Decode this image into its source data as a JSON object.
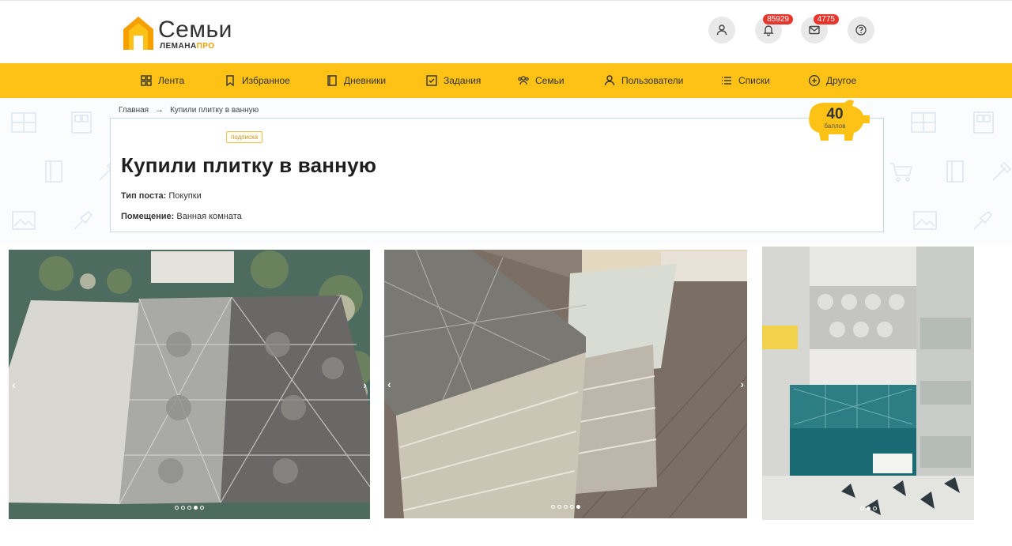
{
  "brand": {
    "title": "Семьи",
    "sub_main": "ЛЕМАНА",
    "sub_pro": "ПРО"
  },
  "header": {
    "notifications_count": "85929",
    "messages_count": "4775"
  },
  "nav": [
    {
      "label": "Лента",
      "icon": "grid-icon"
    },
    {
      "label": "Избранное",
      "icon": "bookmark-icon"
    },
    {
      "label": "Дневники",
      "icon": "book-icon"
    },
    {
      "label": "Задания",
      "icon": "checkbox-icon"
    },
    {
      "label": "Семьи",
      "icon": "people-icon"
    },
    {
      "label": "Пользователи",
      "icon": "user-icon"
    },
    {
      "label": "Списки",
      "icon": "list-icon"
    },
    {
      "label": "Другое",
      "icon": "plus-circle-icon"
    }
  ],
  "breadcrumb": {
    "home": "Главная",
    "arrow": "→",
    "current": "Купили плитку в ванную"
  },
  "post": {
    "tag": "подписка",
    "title": "Купили плитку в ванную",
    "type_label": "Тип поста:",
    "type_value": "Покупки",
    "room_label": "Помещение:",
    "room_value": "Ванная комната"
  },
  "points": {
    "value": "40",
    "label": "баллов"
  },
  "gallery": [
    {
      "dots": 5,
      "active": 3
    },
    {
      "dots": 5,
      "active": 4
    },
    {
      "dots": 3,
      "active": 1
    }
  ],
  "colors": {
    "accent": "#fdc215",
    "badge": "#e8362d",
    "brand_orange": "#f5a000"
  }
}
